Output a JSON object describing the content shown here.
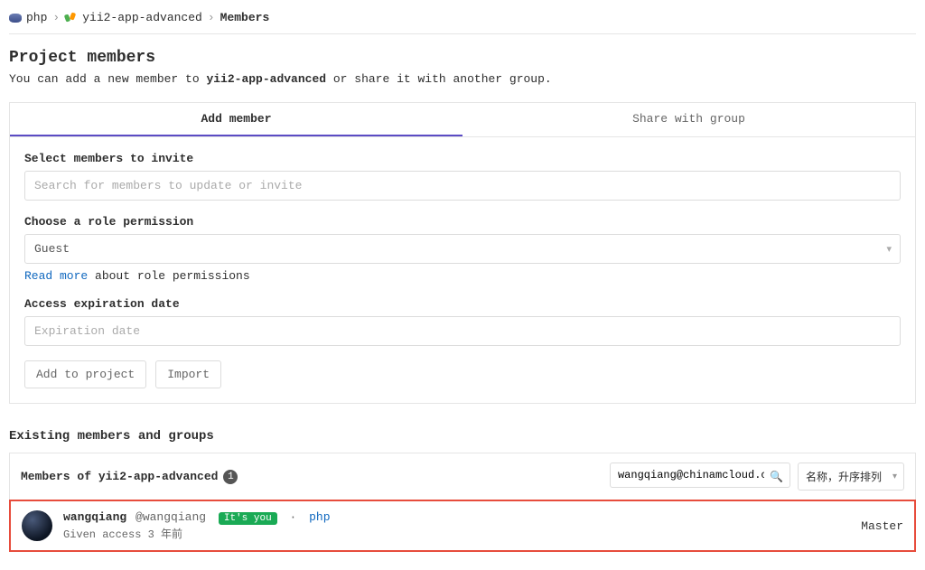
{
  "breadcrumb": {
    "group": "php",
    "project": "yii2-app-advanced",
    "current": "Members"
  },
  "header": {
    "title": "Project members",
    "intro_prefix": "You can add a new member to ",
    "intro_project": "yii2-app-advanced",
    "intro_suffix": " or share it with another group."
  },
  "tabs": {
    "add_member": "Add member",
    "share": "Share with group"
  },
  "invite": {
    "select_label": "Select members to invite",
    "search_placeholder": "Search for members to update or invite",
    "role_label": "Choose a role permission",
    "role_value": "Guest",
    "read_more": "Read more",
    "role_hint_rest": " about role permissions",
    "expire_label": "Access expiration date",
    "expire_placeholder": "Expiration date",
    "add_btn": "Add to project",
    "import_btn": "Import"
  },
  "existing": {
    "heading": "Existing members and groups",
    "members_of_prefix": "Members of ",
    "members_of_project": "yii2-app-advanced",
    "count": "1",
    "filter_value": "wangqiang@chinamcloud.com",
    "sort_value": "名称，升序排列"
  },
  "member": {
    "name": "wangqiang",
    "handle": "@wangqiang",
    "you": "It's you",
    "group": "php",
    "access_line": "Given access 3 年前",
    "role": "Master"
  }
}
